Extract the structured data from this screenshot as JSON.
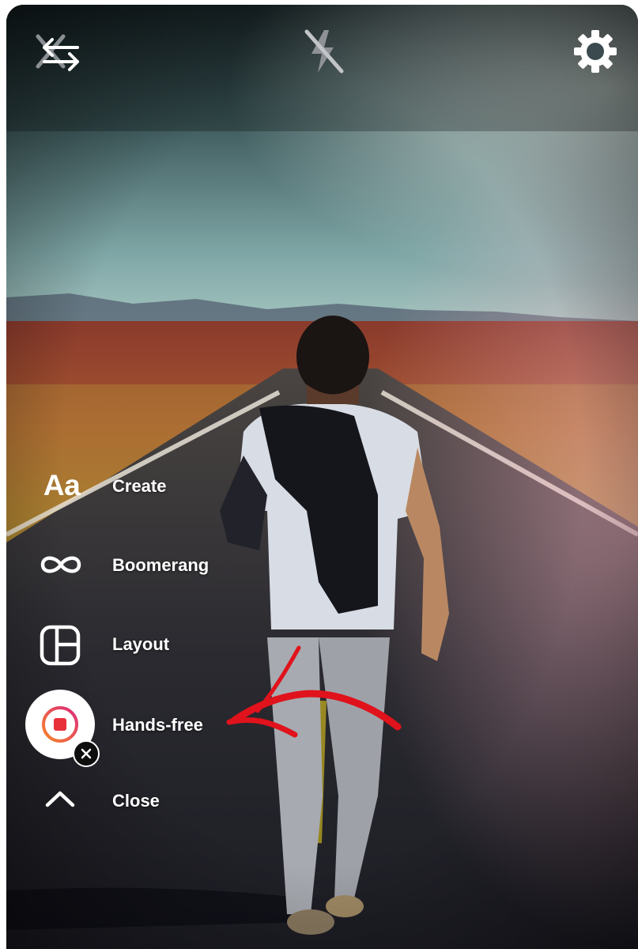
{
  "top_bar": {
    "flip_camera_icon": "flip-camera-icon",
    "flash_icon": "flash-off-icon",
    "settings_icon": "gear-icon"
  },
  "menu": {
    "items": [
      {
        "label": "Create",
        "icon": "Aa"
      },
      {
        "label": "Boomerang",
        "icon": "infinity-icon"
      },
      {
        "label": "Layout",
        "icon": "layout-icon"
      },
      {
        "label": "Hands-free",
        "icon": "record-icon"
      },
      {
        "label": "Close",
        "icon": "chevron-up-icon"
      }
    ]
  },
  "colors": {
    "annotation_arrow": "#e0121b",
    "record_gradient_start": "#f58529",
    "record_gradient_end": "#dd2a7b",
    "record_stop": "#e8303b"
  }
}
